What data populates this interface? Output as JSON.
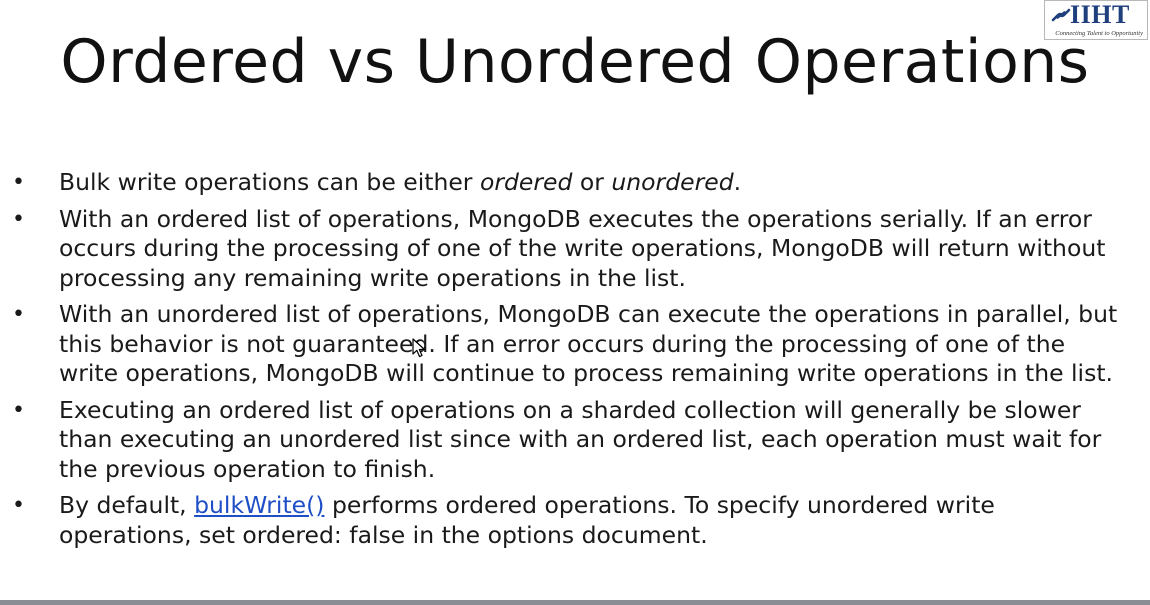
{
  "logo": {
    "text": "IIHT",
    "tagline": "Connecting Talent to Opportunity",
    "brand_color": "#1f3f7d",
    "icon": "chain-link-icon"
  },
  "slide": {
    "title": "Ordered vs Unordered Operations",
    "bullet_glyph": "•",
    "link_color": "#1f4fc7",
    "bullets": [
      {
        "text_before": "Bulk write operations can be either ",
        "em1": "ordered",
        "mid": " or ",
        "em2": "unordered",
        "text_after": "."
      },
      {
        "text": "With an ordered list of operations, MongoDB executes the operations serially. If an error occurs during the processing of one of the write operations, MongoDB will return without processing any remaining write operations in the list."
      },
      {
        "text": "With an unordered list of operations, MongoDB can execute the operations in parallel, but this behavior is not guaranteed. If an error occurs during the processing of one of the write operations, MongoDB will continue to process remaining write operations in the list."
      },
      {
        "text": "Executing an ordered list of operations on a sharded collection will generally be slower than executing an unordered list since with an ordered list, each operation must wait for the previous operation to finish."
      },
      {
        "text_before": "By default, ",
        "link": "bulkWrite()",
        "text_after": " performs ordered operations. To specify unordered write operations, set ordered: false in the options document."
      }
    ]
  }
}
